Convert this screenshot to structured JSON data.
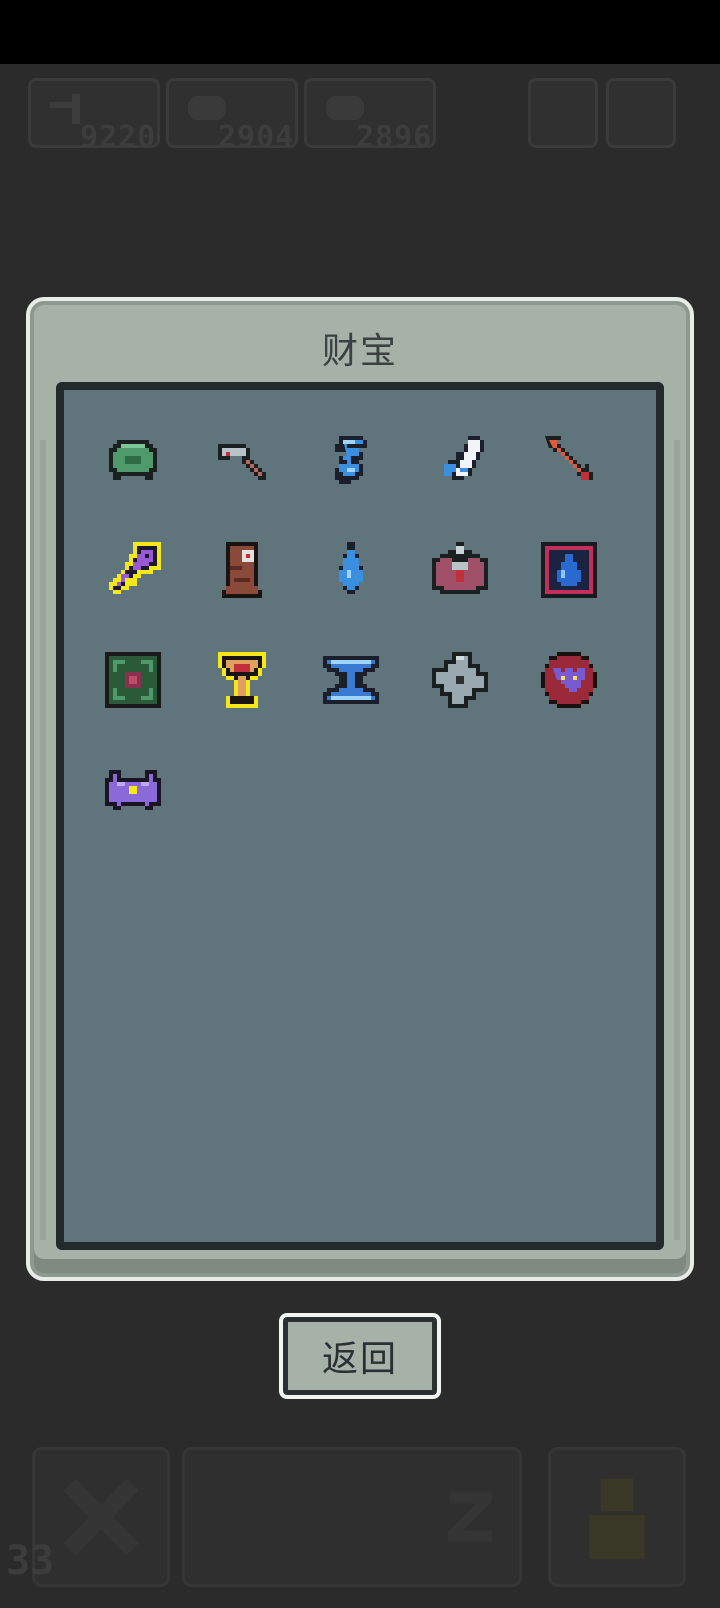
{
  "hud": {
    "counters": [
      {
        "icon": "pickaxe-icon",
        "value": "9220"
      },
      {
        "icon": "creature-icon",
        "value": "2904"
      },
      {
        "icon": "creature-icon",
        "value": "2896"
      }
    ],
    "bottom_count": "33"
  },
  "dialog": {
    "title": "财宝",
    "return_label": "返回"
  },
  "items": [
    {
      "name": "green-shell-icon",
      "highlighted": false
    },
    {
      "name": "hammer-icon",
      "highlighted": false
    },
    {
      "name": "blue-wisp-icon",
      "highlighted": false
    },
    {
      "name": "wing-icon",
      "highlighted": false
    },
    {
      "name": "arrow-icon",
      "highlighted": false
    },
    {
      "name": "purple-key-icon",
      "highlighted": true
    },
    {
      "name": "totem-icon",
      "highlighted": false
    },
    {
      "name": "water-drop-icon",
      "highlighted": false
    },
    {
      "name": "crystal-armor-icon",
      "highlighted": false
    },
    {
      "name": "water-rune-icon",
      "highlighted": false
    },
    {
      "name": "vine-rune-icon",
      "highlighted": false
    },
    {
      "name": "golden-chalice-icon",
      "highlighted": true
    },
    {
      "name": "hourglass-icon",
      "highlighted": false
    },
    {
      "name": "shuriken-icon",
      "highlighted": false
    },
    {
      "name": "bat-emblem-icon",
      "highlighted": false
    },
    {
      "name": "purple-crab-icon",
      "highlighted": false
    }
  ],
  "colors": {
    "dialog_bg": "#a6b1a8",
    "inner_bg": "#5f757b",
    "highlight": "#f5e71a"
  }
}
